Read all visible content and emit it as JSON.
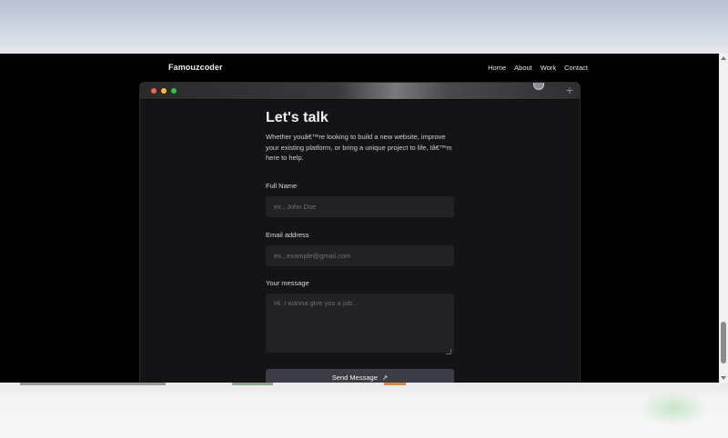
{
  "navbar": {
    "brand": "Famouzcoder",
    "links": [
      "Home",
      "About",
      "Work",
      "Contact"
    ]
  },
  "window": {
    "plus_symbol": "+"
  },
  "contact": {
    "heading": "Let's talk",
    "intro": "Whether youâ€™re looking to build a new website, improve your existing platform, or bring a unique project to life, Iâ€™m here to help.",
    "full_name_label": "Full Name",
    "full_name_placeholder": "ex., John Doe",
    "email_label": "Email address",
    "email_placeholder": "ex., example@gmail.com",
    "message_label": "Your message",
    "message_placeholder": "Hi, I wanna give you a job...",
    "send_label": "Send Message",
    "send_icon": "↗"
  },
  "colors": {
    "background": "#000000",
    "window_bg": "#141416",
    "input_bg": "#222226",
    "button_bg": "#3c3c46"
  }
}
